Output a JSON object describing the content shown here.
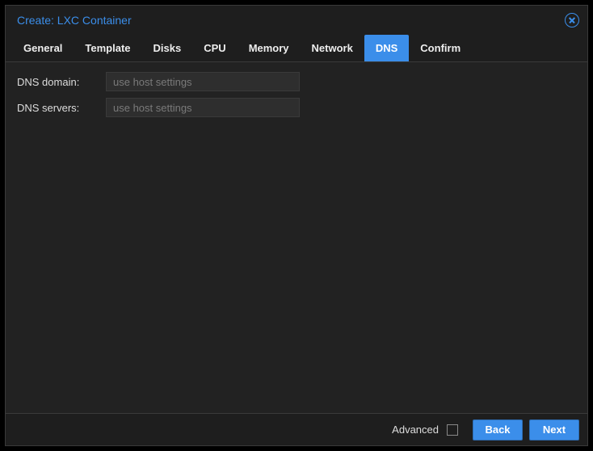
{
  "window": {
    "title": "Create: LXC Container"
  },
  "tabs": {
    "general": "General",
    "template": "Template",
    "disks": "Disks",
    "cpu": "CPU",
    "memory": "Memory",
    "network": "Network",
    "dns": "DNS",
    "confirm": "Confirm",
    "active": "dns"
  },
  "form": {
    "dns_domain": {
      "label": "DNS domain:",
      "value": "",
      "placeholder": "use host settings"
    },
    "dns_servers": {
      "label": "DNS servers:",
      "value": "",
      "placeholder": "use host settings"
    }
  },
  "footer": {
    "advanced_label": "Advanced",
    "advanced_checked": false,
    "back_label": "Back",
    "next_label": "Next"
  }
}
